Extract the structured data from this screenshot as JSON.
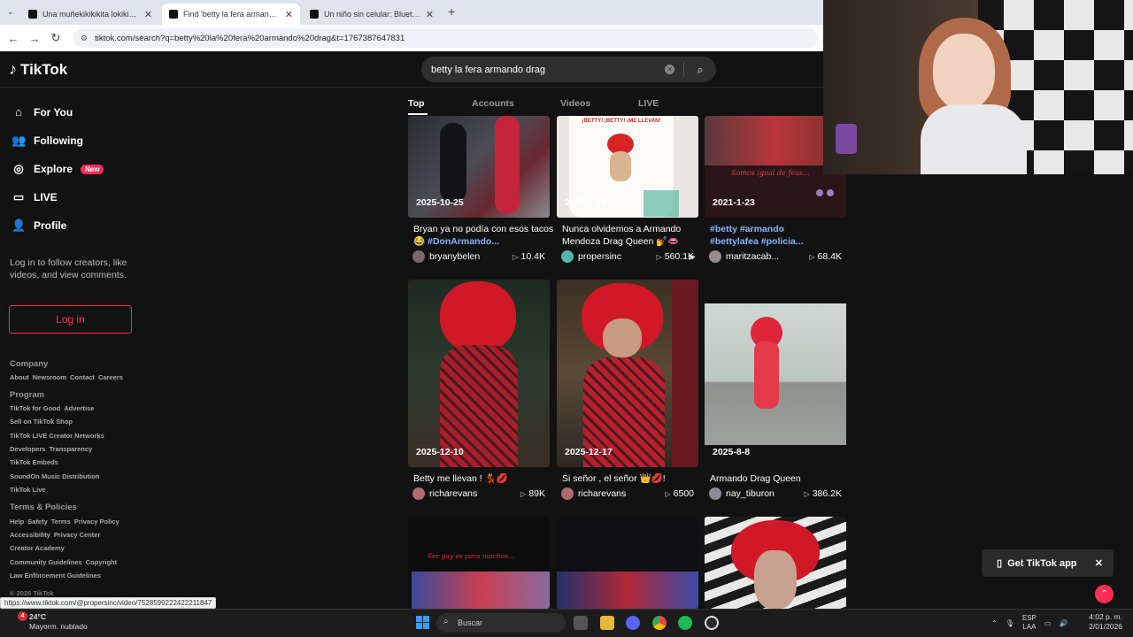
{
  "browser": {
    "tabs": [
      {
        "title": "Una muñekikikikita lokikikita ay",
        "active": false
      },
      {
        "title": "Find 'betty la fera armando drag",
        "active": true
      },
      {
        "title": "Un niño sin celular: Bluetooth y",
        "active": false
      }
    ],
    "url": "tiktok.com/search?q=betty%20la%20fera%20armando%20drag&t=1767387647831",
    "status_url": "https://www.tiktok.com/@propersinc/video/7528599222422211847"
  },
  "header": {
    "logo": "TikTok",
    "search_value": "betty la fera armando drag"
  },
  "sidebar": {
    "items": [
      {
        "label": "For You",
        "icon": "home-icon"
      },
      {
        "label": "Following",
        "icon": "following-icon"
      },
      {
        "label": "Explore",
        "icon": "compass-icon",
        "badge": "New"
      },
      {
        "label": "LIVE",
        "icon": "live-icon"
      },
      {
        "label": "Profile",
        "icon": "profile-icon"
      }
    ],
    "login_message": "Log in to follow creators, like videos, and view comments.",
    "login_button": "Log in",
    "footer": {
      "company": "Company",
      "company_links": [
        "About",
        "Newsroom",
        "Contact",
        "Careers"
      ],
      "program": "Program",
      "program_lines": [
        [
          "TikTok for Good",
          "Advertise"
        ],
        [
          "Sell on TikTok Shop"
        ],
        [
          "TikTok LIVE Creator Networks"
        ],
        [
          "Developers",
          "Transparency"
        ],
        [
          "TikTok Embeds"
        ],
        [
          "SoundOn Music Distribution"
        ],
        [
          "TikTok Live"
        ]
      ],
      "terms": "Terms & Policies",
      "terms_lines": [
        [
          "Help",
          "Safety",
          "Terms",
          "Privacy Policy"
        ],
        [
          "Accessibility",
          "Privacy Center"
        ],
        [
          "Creator Academy"
        ],
        [
          "Community Guidelines",
          "Copyright"
        ],
        [
          "Law Enforcement Guidelines"
        ]
      ],
      "copyright": "© 2026 TikTok"
    }
  },
  "search_tabs": [
    "Top",
    "Accounts",
    "Videos",
    "LIVE"
  ],
  "videos": [
    {
      "date": "2025-10-25",
      "caption": "Bryan ya no podía con esos tacos 😂 ",
      "tags": "#DonArmando...",
      "user": "bryanybelen",
      "views": "10.4K"
    },
    {
      "date": "2025-7-18",
      "caption": "Nunca olvidemos a Armando Mendoza Drag Queen 💅👄",
      "tags": "",
      "user": "propersinc",
      "views": "560.1K"
    },
    {
      "date": "2021-1-23",
      "caption": "",
      "tags": "#betty #armando #bettylafea #policia...",
      "user": "maritzacab...",
      "views": "68.4K"
    },
    {
      "date": "2025-12-10",
      "caption": "Betty me llevan ! 💃💋",
      "tags": "",
      "user": "richarevans",
      "views": "89K"
    },
    {
      "date": "2025-12-17",
      "caption": "Si señor , el señor 👑💋!",
      "tags": "",
      "user": "richarevans",
      "views": "6500"
    },
    {
      "date": "2025-8-8",
      "caption": "Armando Drag Queen",
      "tags": "",
      "user": "nay_tiburon",
      "views": "386.2K"
    }
  ],
  "thumb_texts": {
    "mug": "¡BETTY! ¡BETTY! ¡ME LLEVAN!",
    "overlay1": "Somos igual de feas...",
    "overlay2": "Ser gay es para machos..."
  },
  "get_app": "Get TikTok app",
  "taskbar": {
    "temp": "24°C",
    "weather": "Mayorm. nublado",
    "notif_count": "4",
    "search_placeholder": "Buscar",
    "lang": "ESP",
    "lang_sub": "LAA",
    "time": "4:02 p. m.",
    "date": "2/01/2026"
  }
}
